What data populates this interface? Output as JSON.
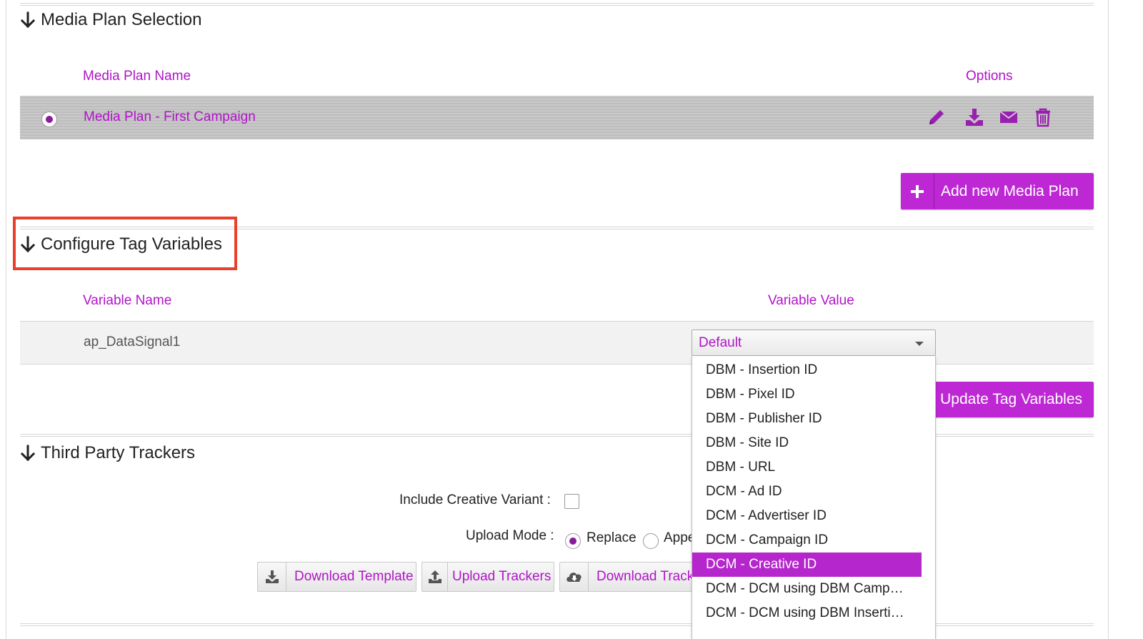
{
  "media_plan_section": {
    "title": "Media Plan Selection",
    "col_name": "Media Plan Name",
    "col_options": "Options",
    "plans": [
      {
        "name": "Media Plan - First Campaign",
        "selected": true
      }
    ],
    "option_icons": [
      "pencil-icon",
      "download-icon",
      "envelope-icon",
      "trash-icon"
    ],
    "add_button": "Add new Media Plan"
  },
  "tag_section": {
    "title": "Configure Tag Variables",
    "col_name": "Variable Name",
    "col_value": "Variable Value",
    "variable_name": "ap_DataSignal1",
    "selected_value": "Default",
    "update_button": "Update Tag Variables",
    "options": [
      "DBM - Insertion ID",
      "DBM - Pixel ID",
      "DBM - Publisher ID",
      "DBM - Site ID",
      "DBM - URL",
      "DCM - Ad ID",
      "DCM - Advertiser ID",
      "DCM - Campaign ID",
      "DCM - Creative ID",
      "DCM - DCM using DBM Camp…",
      "DCM - DCM using DBM Inserti…"
    ],
    "highlighted_option": "DCM - Creative ID"
  },
  "trackers_section": {
    "title": "Third Party Trackers",
    "include_variant_label": "Include Creative Variant :",
    "upload_mode_label": "Upload Mode :",
    "mode_replace": "Replace",
    "mode_append_visible": "Appe",
    "download_template": "Download Template",
    "upload_trackers": "Upload Trackers",
    "download_trackers_visible": "Download Track"
  },
  "colors": {
    "accent": "#bd28d4",
    "link": "#b014c8",
    "highlight_box": "#e8402a"
  }
}
